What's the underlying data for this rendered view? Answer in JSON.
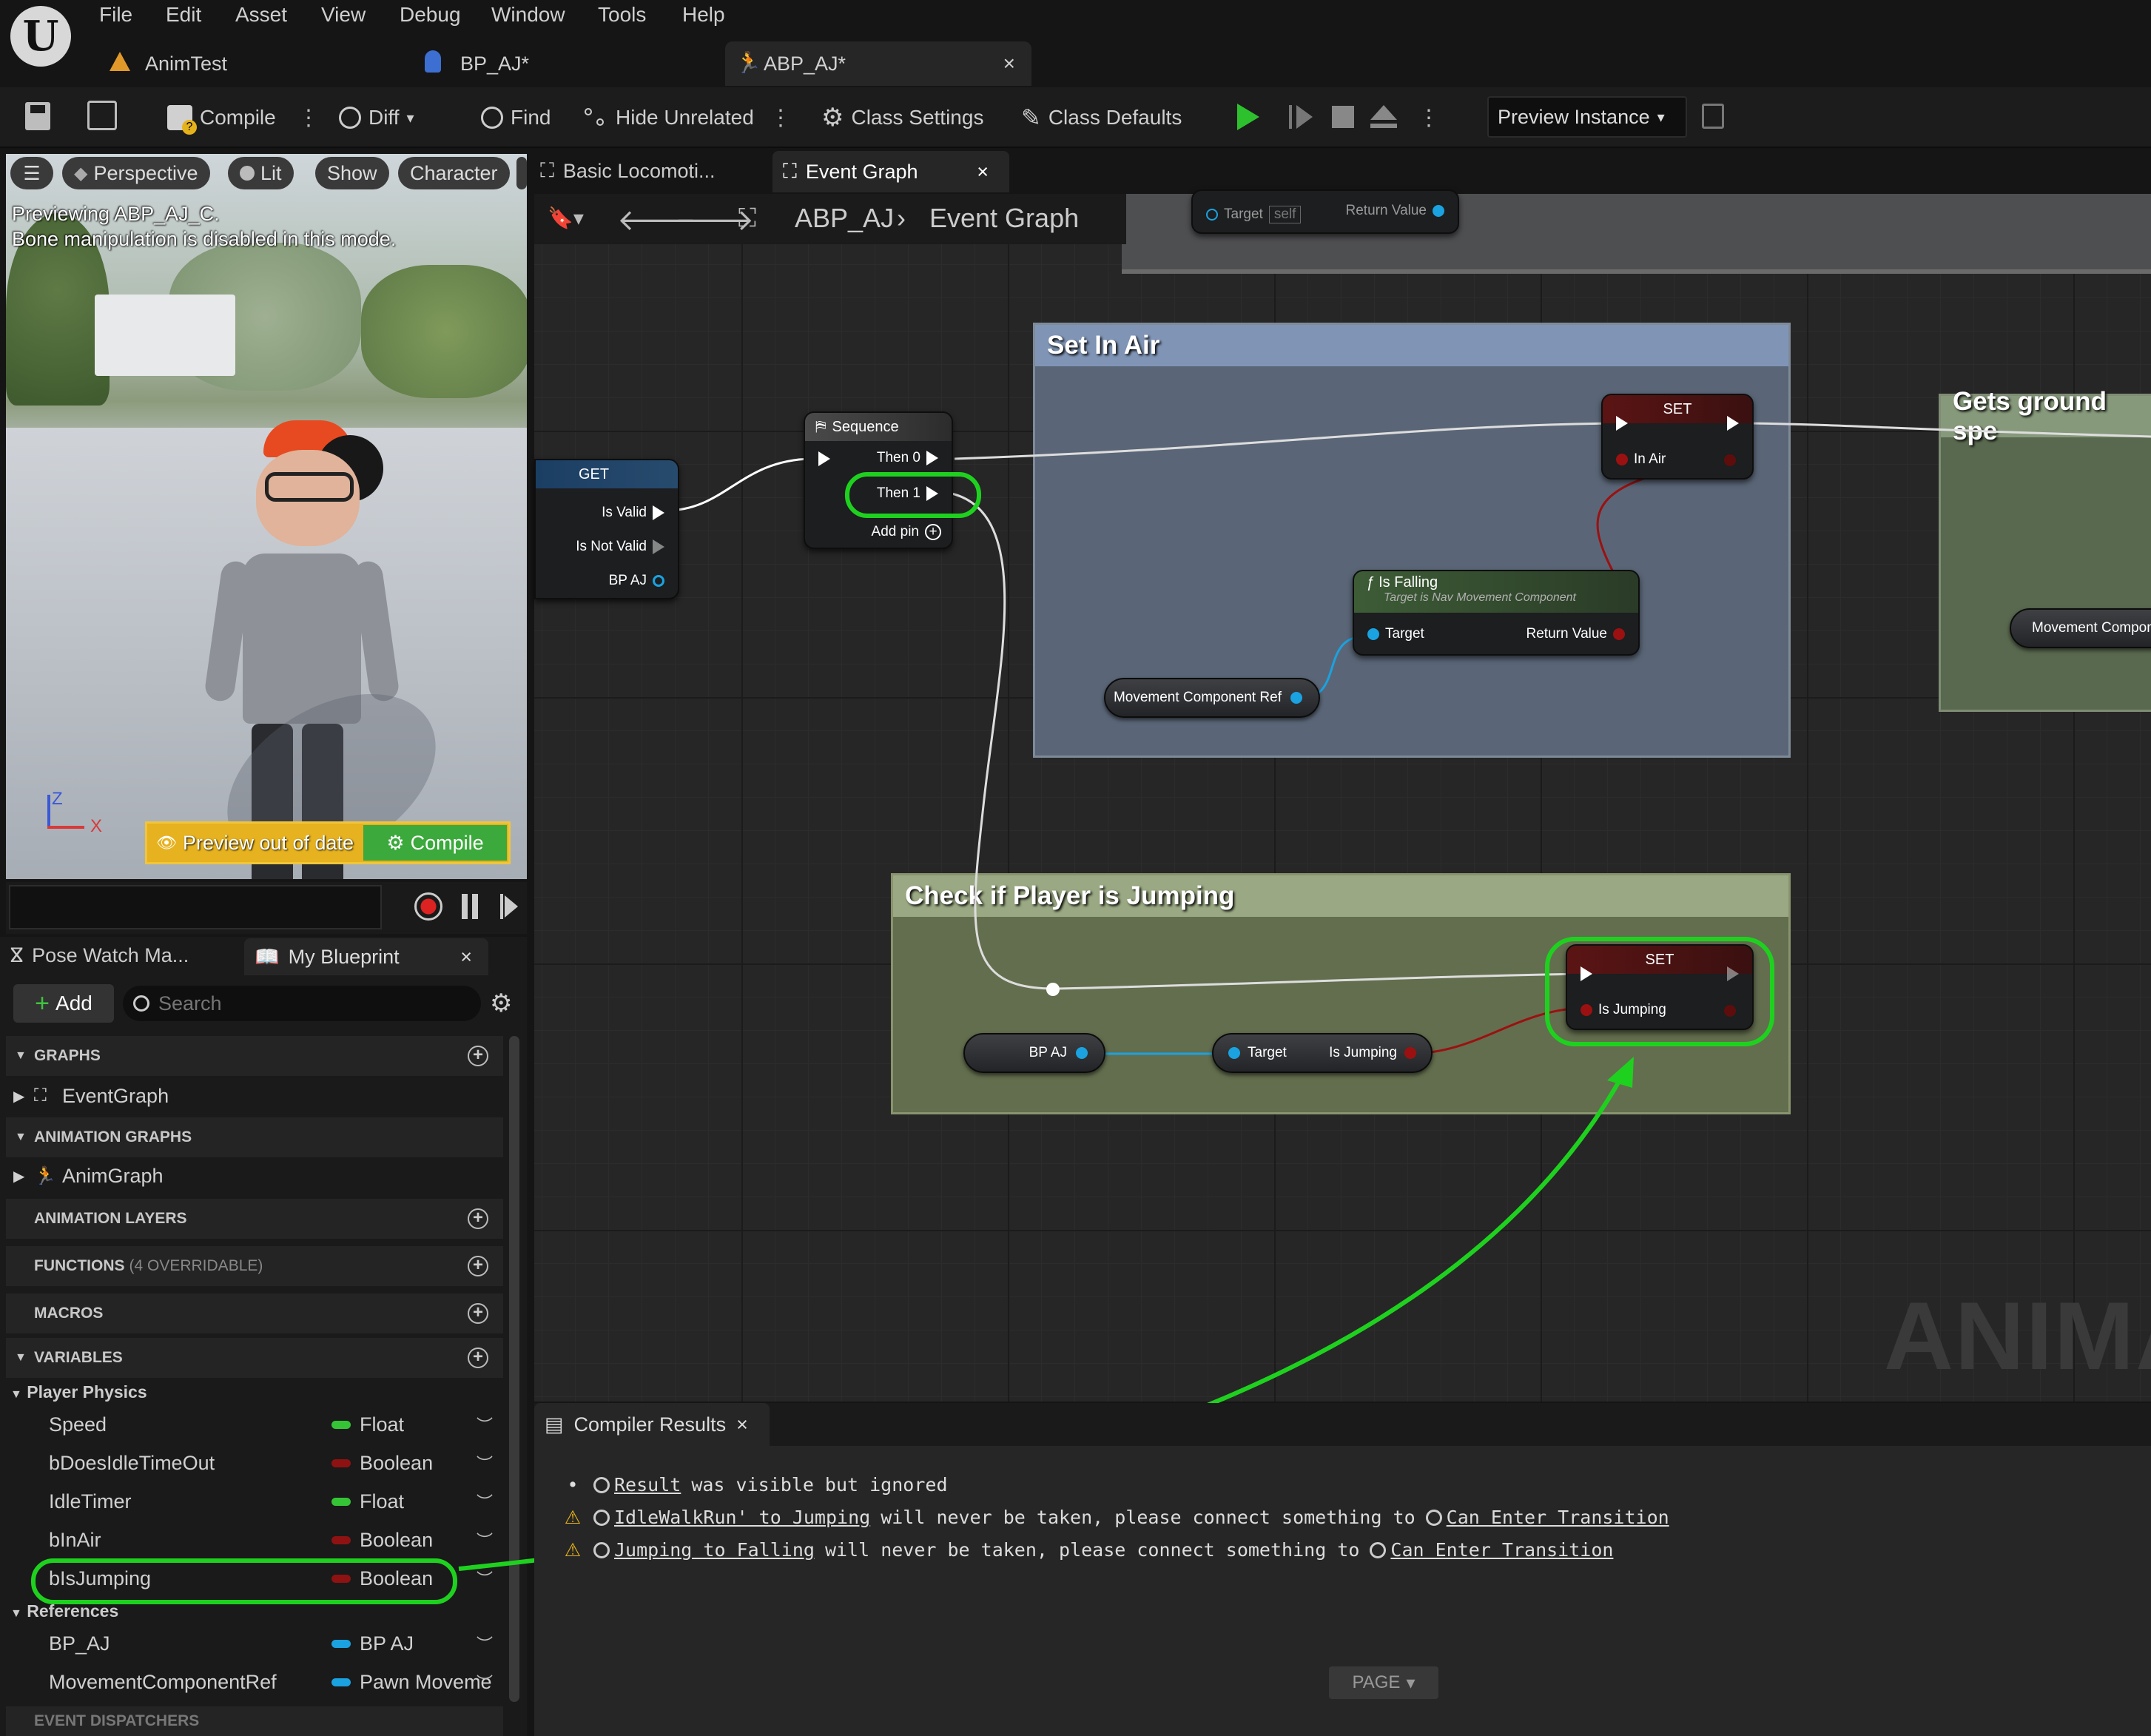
{
  "menu": {
    "items": [
      "File",
      "Edit",
      "Asset",
      "View",
      "Debug",
      "Window",
      "Tools",
      "Help"
    ]
  },
  "tabs": [
    {
      "label": "AnimTest",
      "close": ""
    },
    {
      "label": "BP_AJ*",
      "close": ""
    },
    {
      "label": "ABP_AJ*",
      "close": "×"
    }
  ],
  "toolbar": {
    "compile": "Compile",
    "diff": "Diff",
    "find": "Find",
    "hide_unrelated": "Hide Unrelated",
    "class_settings": "Class Settings",
    "class_defaults": "Class Defaults",
    "preview_instance": "Preview Instance"
  },
  "viewport": {
    "perspective": "Perspective",
    "lit": "Lit",
    "show": "Show",
    "character": "Character",
    "overlay_line1": "Previewing ABP_AJ_C.",
    "overlay_line2": "Bone manipulation is disabled in this mode.",
    "axis_z": "Z",
    "axis_x": "X",
    "preview_out_of_date": "Preview out of date",
    "compile": "Compile"
  },
  "left_tabs": {
    "pose_watch": "Pose Watch Ma...",
    "my_blueprint": "My Blueprint",
    "close": "×"
  },
  "my_blueprint": {
    "add": "Add",
    "search_placeholder": "Search",
    "graphs": "GRAPHS",
    "event_graph": "EventGraph",
    "animation_graphs": "ANIMATION GRAPHS",
    "anim_graph": "AnimGraph",
    "animation_layers": "ANIMATION LAYERS",
    "functions": "FUNCTIONS",
    "functions_note": "(4 OVERRIDABLE)",
    "macros": "MACROS",
    "variables": "VARIABLES",
    "cat_physics": "Player Physics",
    "cat_refs": "References",
    "event_dispatchers": "EVENT DISPATCHERS",
    "vars_physics": [
      {
        "name": "Speed",
        "type": "Float",
        "color": "#35c435"
      },
      {
        "name": "bDoesIdleTimeOut",
        "type": "Boolean",
        "color": "#8e1212"
      },
      {
        "name": "IdleTimer",
        "type": "Float",
        "color": "#35c435"
      },
      {
        "name": "bInAir",
        "type": "Boolean",
        "color": "#8e1212"
      },
      {
        "name": "bIsJumping",
        "type": "Boolean",
        "color": "#8e1212"
      }
    ],
    "vars_refs": [
      {
        "name": "BP_AJ",
        "type": "BP AJ",
        "color": "#1ba2e0"
      },
      {
        "name": "MovementComponentRef",
        "type": "Pawn Moveme",
        "color": "#1ba2e0"
      }
    ]
  },
  "graph_tabs": {
    "basic_locomotion": "Basic Locomoti...",
    "event_graph": "Event Graph",
    "close": "×"
  },
  "breadcrumb": {
    "root": "ABP_AJ",
    "current": "Event Graph"
  },
  "graph": {
    "top_node": {
      "target": "Target",
      "self": "self",
      "return_value": "Return Value"
    },
    "get_node": {
      "title": "GET",
      "is_valid": "Is Valid",
      "is_not_valid": "Is Not Valid",
      "bp_aj": "BP AJ"
    },
    "sequence": {
      "title": "Sequence",
      "then0": "Then 0",
      "then1": "Then 1",
      "add_pin": "Add pin"
    },
    "comment_air": "Set In Air",
    "comment_ground": "Gets ground spe",
    "comment_jump": "Check if Player is Jumping",
    "set_air": {
      "title": "SET",
      "pin": "In Air"
    },
    "is_falling": {
      "title": "Is Falling",
      "subtitle": "Target is Nav Movement Component",
      "target": "Target",
      "return_value": "Return Value"
    },
    "movement_ref": "Movement Component Ref",
    "movement_ref_right": "Movement Compone",
    "set_jump": {
      "title": "SET",
      "pin": "Is Jumping"
    },
    "bp_aj_node": "BP AJ",
    "is_jumping_get": {
      "target": "Target",
      "value": "Is Jumping"
    },
    "watermark": "ANIMAT"
  },
  "compiler": {
    "tab": "Compiler Results",
    "close": "×",
    "m1a": "Result",
    "m1b": "was visible but ignored",
    "m2a": "IdleWalkRun' to Jumping",
    "m2b": "will never be taken, please connect something to",
    "m2c": "Can Enter Transition",
    "m3a": "Jumping to Falling",
    "m3b": "will never be taken, please connect something to",
    "m3c": "Can Enter Transition",
    "page": "PAGE"
  },
  "colors": {
    "highlight": "#1fd11f",
    "bool": "#8e1212",
    "float": "#35c435",
    "object": "#1ba2e0"
  }
}
